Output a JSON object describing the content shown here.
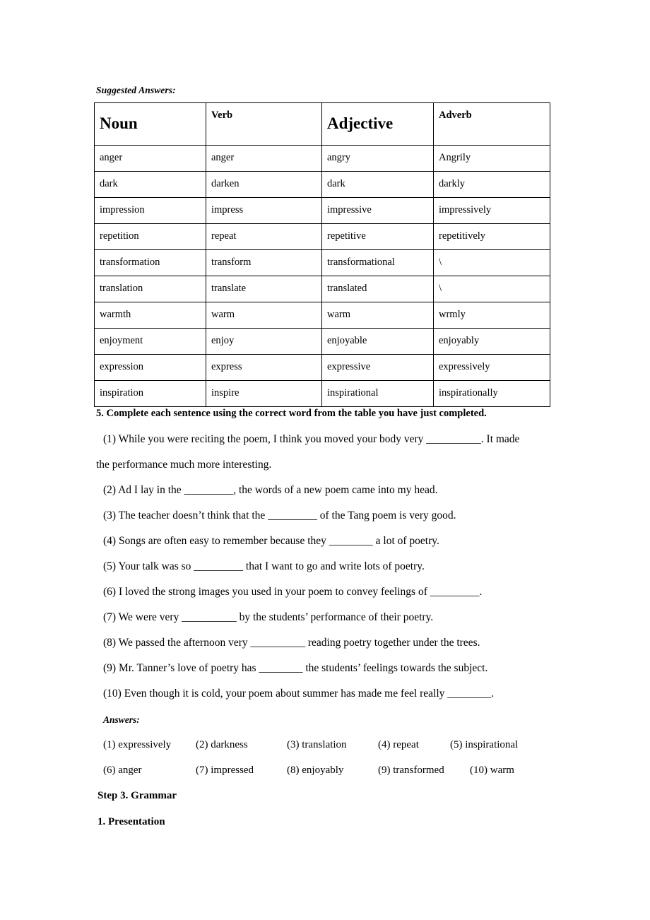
{
  "document": {
    "suggested_answers_label": "Suggested Answers:",
    "answers_label": "Answers:"
  },
  "word_table": {
    "headers": [
      "Noun",
      "Verb",
      "Adjective",
      "Adverb"
    ],
    "rows": [
      [
        "anger",
        "anger",
        "angry",
        "Angrily"
      ],
      [
        "dark",
        "darken",
        "dark",
        "darkly"
      ],
      [
        "impression",
        "impress",
        "impressive",
        "impressively"
      ],
      [
        "repetition",
        "repeat",
        "repetitive",
        "repetitively"
      ],
      [
        "transformation",
        "transform",
        "transformational",
        "\\"
      ],
      [
        "translation",
        "translate",
        "translated",
        "\\"
      ],
      [
        "warmth",
        "warm",
        "warm",
        "wrmly"
      ],
      [
        "enjoyment",
        "enjoy",
        "enjoyable",
        "enjoyably"
      ],
      [
        "expression",
        "express",
        "expressive",
        "expressively"
      ],
      [
        "inspiration",
        "inspire",
        "inspirational",
        "inspirationally"
      ]
    ]
  },
  "exercise": {
    "heading": "5. Complete each sentence using the correct word from the table you have just completed.",
    "lines": [
      "(1) While you were reciting the poem, I think you moved your body very __________. It made",
      "the performance much more interesting.",
      "(2) Ad I lay in the _________, the words of a new poem came into my head.",
      "(3) The teacher doesn’t think that the _________ of the Tang poem is very good.",
      "(4) Songs are often easy to remember because they ________ a lot of   poetry.",
      "(5) Your talk was so _________ that I want to go and write lots of poetry.",
      "(6) I loved the strong images you used in your poem to convey feelings of _________.",
      "(7) We were very __________ by the students’ performance of their poetry.",
      "(8) We passed the afternoon very __________ reading poetry together under the trees.",
      "(9) Mr. Tanner’s love of poetry has ________ the students’ feelings towards the subject.",
      "(10) Even though it is cold, your poem about summer has made me feel really ________."
    ]
  },
  "answers": {
    "row1": [
      "(1) expressively",
      "(2) darkness",
      "(3) translation",
      "(4) repeat",
      "(5) inspirational"
    ],
    "row2": [
      "(6) anger",
      "(7) impressed",
      "(8) enjoyably",
      "(9) transformed",
      "(10) warm"
    ]
  },
  "footer_headings": {
    "step": "Step 3. Grammar",
    "presentation": "1. Presentation"
  }
}
